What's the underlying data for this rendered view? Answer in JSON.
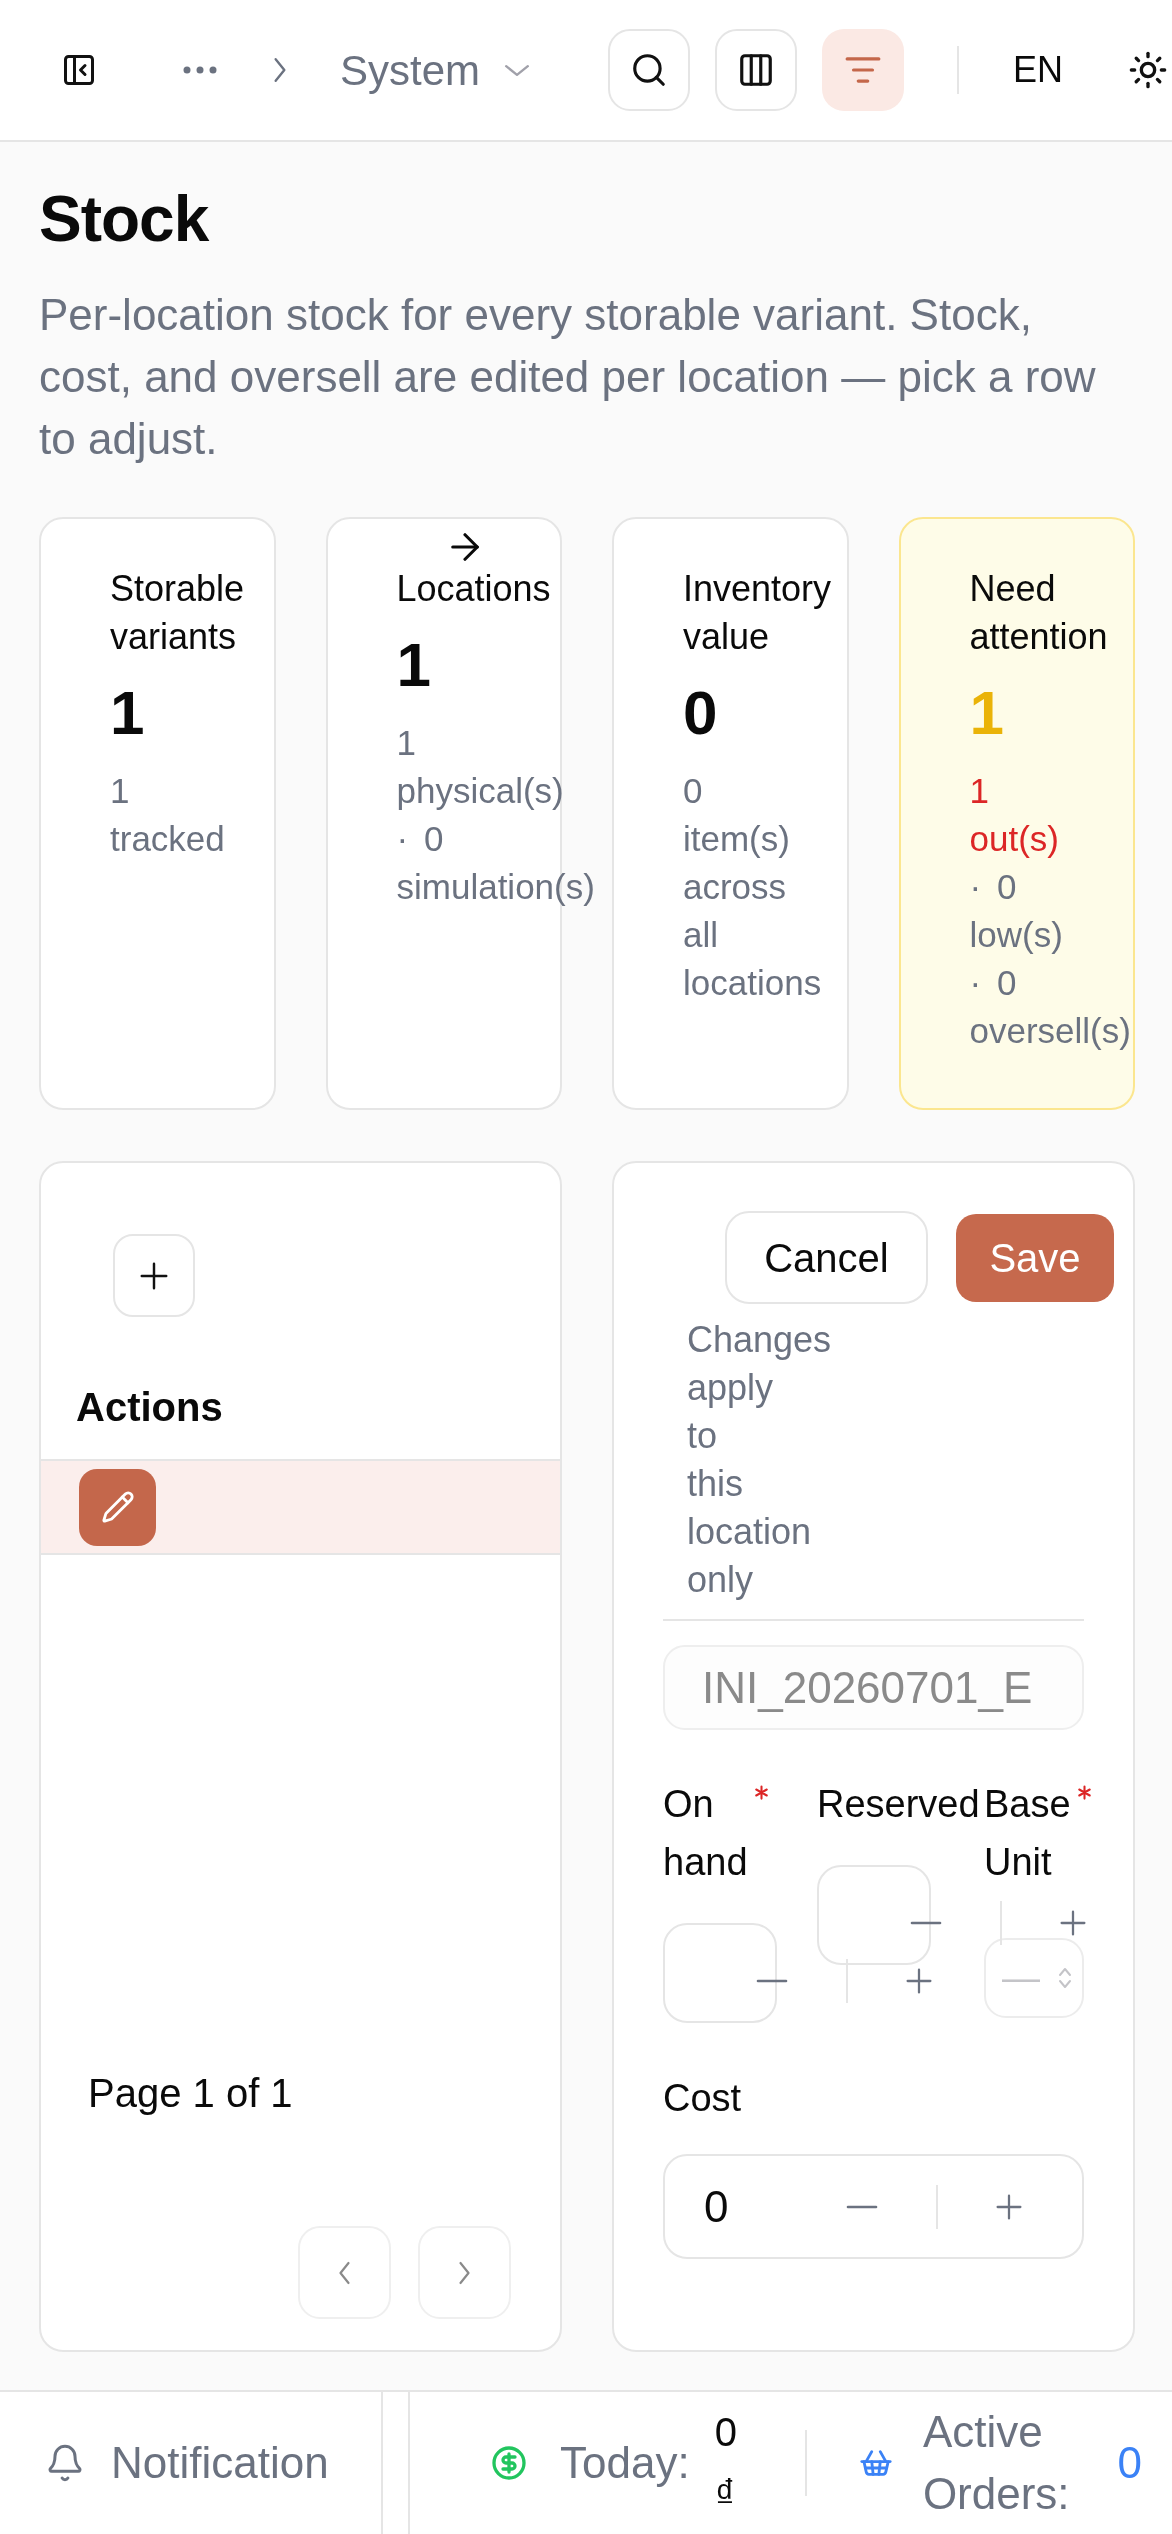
{
  "header": {
    "breadcrumb_current": "System",
    "toolbar_buttons": [
      {
        "kind": "search",
        "active": false
      },
      {
        "kind": "columns",
        "active": false
      },
      {
        "kind": "filter",
        "active": true
      }
    ],
    "language": "EN"
  },
  "page": {
    "title": "Stock",
    "description": "Per-location stock for every storable variant. Stock, cost, and oversell are edited per location — pick a row to adjust."
  },
  "stats": [
    {
      "kind": "plain",
      "label": "Storable variants",
      "value": "1",
      "details": [
        {
          "text": "1 tracked",
          "kind": "muted"
        }
      ]
    },
    {
      "kind": "link",
      "label": "Locations",
      "value": "1",
      "details": [
        {
          "text": "1 physical(s)",
          "kind": "muted"
        },
        {
          "text": "· 0 simulation(s)",
          "kind": "muted"
        }
      ]
    },
    {
      "kind": "plain",
      "label": "Inventory value",
      "value": "0",
      "details": [
        {
          "text": "0 item(s) across all locations",
          "kind": "muted"
        }
      ]
    },
    {
      "kind": "warning",
      "label": "Need attention",
      "value": "1",
      "details": [
        {
          "text": "1 out(s)",
          "kind": "alert"
        },
        {
          "text": "· 0 low(s)",
          "kind": "muted"
        },
        {
          "text": "· 0 oversell(s)",
          "kind": "muted"
        }
      ]
    }
  ],
  "list_panel": {
    "columns": [
      "Actions"
    ],
    "rows": [
      {
        "selected": true
      }
    ],
    "pagination": {
      "label": "Page 1 of 1",
      "previous_disabled": true,
      "next_disabled": true
    }
  },
  "editor": {
    "actions": [
      {
        "kind": "secondary",
        "label": "Cancel"
      },
      {
        "kind": "primary",
        "label": "Save"
      }
    ],
    "note": "Changes apply to this location only",
    "reference_field": {
      "value": "INI_20260701_E",
      "disabled": true
    },
    "fields": [
      {
        "kind": "stepper",
        "label": "On hand",
        "required": true
      },
      {
        "kind": "stepper",
        "label": "Reserved",
        "required": false
      },
      {
        "kind": "select",
        "label": "Base Unit",
        "required": true,
        "placeholder": "—"
      }
    ],
    "cost_field": {
      "label": "Cost",
      "value": "0"
    }
  },
  "footer": {
    "notification": "Notification",
    "today_label": "Today:",
    "today_value": "0 ₫",
    "orders_label": "Active Orders:",
    "orders_value": "0"
  }
}
